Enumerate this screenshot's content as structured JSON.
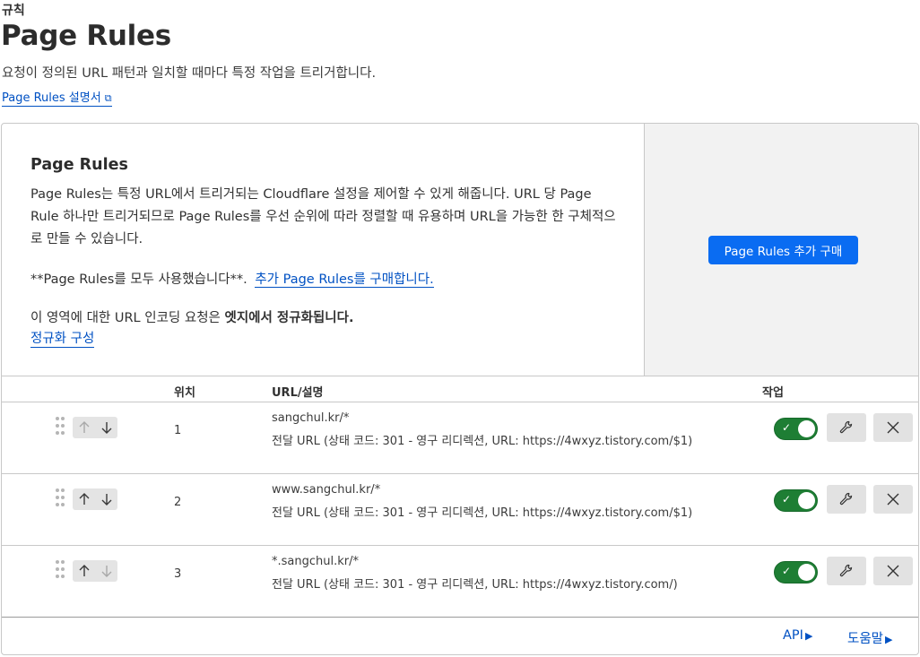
{
  "breadcrumb": "규칙",
  "page_title": "Page Rules",
  "subtitle": "요청이 정의된 URL 패턴과 일치할 때마다 특정 작업을 트리거합니다.",
  "doc_link": "Page Rules 설명서",
  "info": {
    "title": "Page Rules",
    "description": "Page Rules는 특정 URL에서 트리거되는 Cloudflare 설정을 제어할 수 있게 해줍니다. URL 당 Page Rule 하나만 트리거되므로 Page Rules를 우선 순위에 따라 정렬할 때 유용하며 URL을 가능한 한 구체적으로 만들 수 있습니다.",
    "quota_text": "**Page Rules를 모두 사용했습니다**.",
    "quota_link": "추가 Page Rules를 구매합니다.",
    "norm_text": "이 영역에 대한 URL 인코딩 요청은 ",
    "norm_bold": "엣지에서 정규화됩니다.",
    "norm_link": "정규화 구성"
  },
  "buy_button": "Page Rules 추가 구매",
  "table": {
    "headers": {
      "position": "위치",
      "url": "URL/설명",
      "action": "작업"
    },
    "rows": [
      {
        "position": "1",
        "url": "sangchul.kr/*",
        "desc": "전달 URL (상태 코드: 301 - 영구 리디렉션, URL: https://4wxyz.tistory.com/$1)",
        "enabled": true,
        "up_disabled": true,
        "down_disabled": false
      },
      {
        "position": "2",
        "url": "www.sangchul.kr/*",
        "desc": "전달 URL (상태 코드: 301 - 영구 리디렉션, URL: https://4wxyz.tistory.com/$1)",
        "enabled": true,
        "up_disabled": false,
        "down_disabled": false
      },
      {
        "position": "3",
        "url": "*.sangchul.kr/*",
        "desc": "전달 URL (상태 코드: 301 - 영구 리디렉션, URL: https://4wxyz.tistory.com/)",
        "enabled": true,
        "up_disabled": false,
        "down_disabled": true
      }
    ]
  },
  "footer": {
    "api": "API",
    "help": "도움말"
  },
  "colors": {
    "link": "#0051c3",
    "button": "#0a6cf2",
    "toggle_on": "#1e7e34",
    "panel_bg": "#f2f2f2"
  }
}
